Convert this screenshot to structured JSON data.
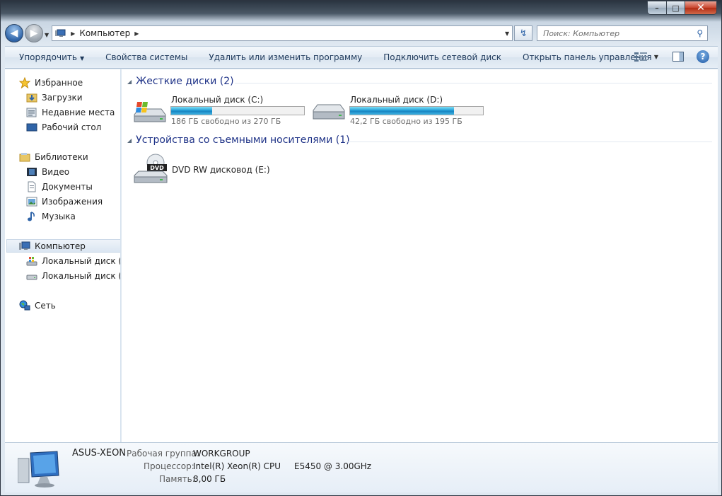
{
  "window": {
    "minimize_glyph": "–",
    "maximize_glyph": "□",
    "close_glyph": "✕"
  },
  "nav": {
    "back_glyph": "◀",
    "forward_glyph": "▶",
    "address_path": "Компьютер",
    "refresh_glyph": "↯",
    "search_placeholder": "Поиск: Компьютер",
    "search_icon": "magnifier-icon"
  },
  "commands": {
    "organize": "Упорядочить",
    "system_properties": "Свойства системы",
    "uninstall": "Удалить или изменить программу",
    "map_drive": "Подключить сетевой диск",
    "control_panel": "Открыть панель управления",
    "help_glyph": "?"
  },
  "sidebar": {
    "favorites": "Избранное",
    "downloads": "Загрузки",
    "recent": "Недавние места",
    "desktop": "Рабочий стол",
    "libraries": "Библиотеки",
    "video": "Видео",
    "documents": "Документы",
    "images": "Изображения",
    "music": "Музыка",
    "computer": "Компьютер",
    "drive_c": "Локальный диск (C:",
    "drive_d": "Локальный диск (D:",
    "network": "Сеть"
  },
  "main": {
    "hard_disks_header": "Жесткие диски (2)",
    "removable_header": "Устройства со съемными носителями (1)",
    "drives": [
      {
        "name": "Локальный диск (C:)",
        "free": "186 ГБ свободно из 270 ГБ",
        "used_fraction": 0.31,
        "icon": "windows-drive-icon"
      },
      {
        "name": "Локальный диск (D:)",
        "free": "42,2 ГБ свободно из 195 ГБ",
        "used_fraction": 0.78,
        "icon": "hard-drive-icon"
      }
    ],
    "dvd": {
      "name": "DVD RW дисковод (E:)",
      "badge": "DVD",
      "icon": "dvd-drive-icon"
    }
  },
  "details": {
    "computer_name": "ASUS-XEON",
    "workgroup_label": "Рабочая группа:",
    "workgroup_value": "WORKGROUP",
    "cpu_label": "Процессор:",
    "cpu_value": "Intel(R) Xeon(R) CPU",
    "cpu_model": "E5450  @ 3.00GHz",
    "ram_label": "Память:",
    "ram_value": "8,00 ГБ"
  },
  "colors": {
    "accent": "#1e3287",
    "bar_fill": "#26a0da"
  }
}
